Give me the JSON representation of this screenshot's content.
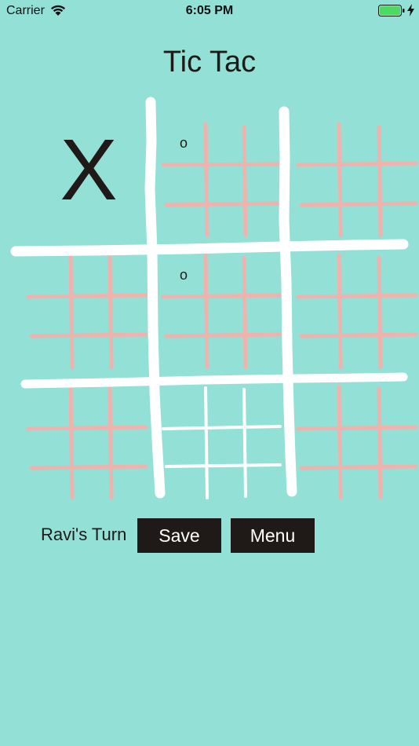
{
  "status_bar": {
    "carrier": "Carrier",
    "time": "6:05 PM",
    "wifi_icon": "wifi-icon",
    "battery_icon": "battery-icon",
    "charging_icon": "charging-bolt-icon",
    "battery_color": "#4cd964"
  },
  "title": "Tic Tac",
  "current_player_mark": "X",
  "board": {
    "marks": [
      {
        "board": 1,
        "cell": 0,
        "value": "o"
      },
      {
        "board": 4,
        "cell": 0,
        "value": "o"
      }
    ],
    "active_board": 7,
    "colors": {
      "outer_lines": "#ffffff",
      "inner_lines": "#f0b2ad",
      "active_inner_lines": "#ffffff"
    }
  },
  "controls": {
    "turn_label": "Ravi's Turn",
    "save_label": "Save",
    "menu_label": "Menu"
  },
  "colors": {
    "background": "#93e0d6",
    "text": "#1f1a17",
    "button_bg": "#1f1a17",
    "button_text": "#ffffff"
  }
}
